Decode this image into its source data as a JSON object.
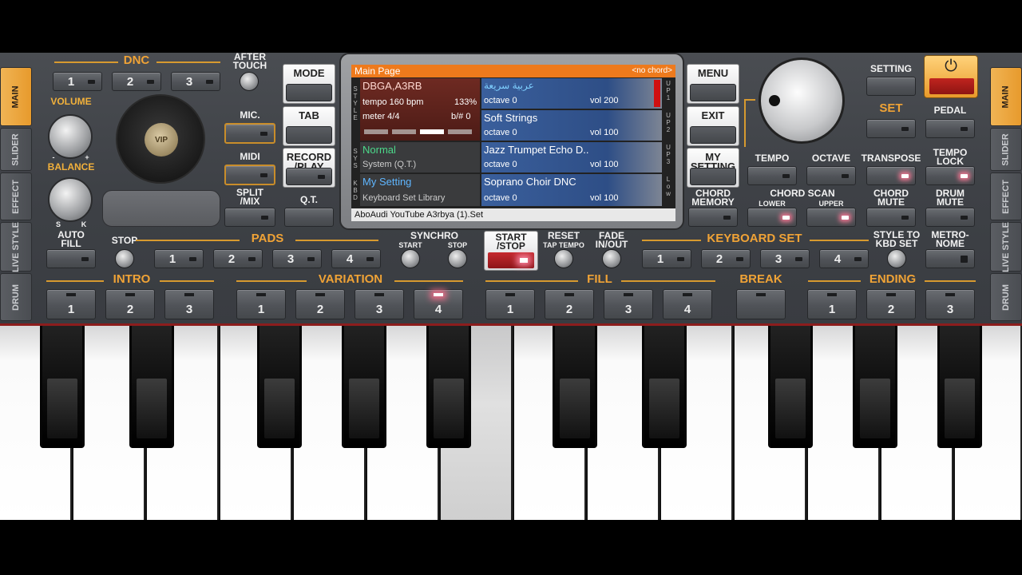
{
  "side_tabs_left": [
    "MAIN",
    "SLIDER",
    "EFFECT",
    "LIVE STYLE",
    "DRUM"
  ],
  "side_tabs_right": [
    "MAIN",
    "SLIDER",
    "EFFECT",
    "LIVE STYLE",
    "DRUM"
  ],
  "dnc": {
    "label": "DNC",
    "buttons": [
      "1",
      "2",
      "3"
    ]
  },
  "after_touch": "AFTER TOUCH",
  "volume": "VOLUME",
  "balance": "BALANCE",
  "balance_s": "S",
  "balance_k": "K",
  "knob_minus": "-",
  "knob_plus": "+",
  "vip": "VIP",
  "mic": "MIC.",
  "midi": "MIDI",
  "split_mix": "SPLIT /MIX",
  "mode": "MODE",
  "tab": "TAB",
  "record_play": "RECORD /PLAY",
  "qt": "Q.T.",
  "menu": "MENU",
  "exit": "EXIT",
  "my_setting": "MY SETTING",
  "chord_memory": "CHORD MEMORY",
  "setting": "SETTING",
  "set": "SET",
  "pedal": "PEDAL",
  "tempo": "TEMPO",
  "octave": "OCTAVE",
  "transpose": "TRANSPOSE",
  "tempo_lock": "TEMPO LOCK",
  "chord_scan": "CHORD SCAN",
  "lower": "LOWER",
  "upper": "UPPER",
  "chord_mute": "CHORD MUTE",
  "drum_mute": "DRUM MUTE",
  "screen": {
    "header": "Main Page",
    "no_chord": "<no chord>",
    "style_name": "DBGA,A3RB",
    "tempo": "tempo 160 bpm",
    "tempo_pct": "133%",
    "meter": "meter 4/4",
    "bsharp": "b/# 0",
    "sys_mode": "Normal",
    "sys_sub": "System (Q.T.)",
    "kbd_name": "My Setting",
    "kbd_sub": "Keyboard Set Library",
    "footer": "AboAudi YouTube A3rbya (1).Set",
    "vert_style": "STYLE",
    "vert_sys": "SYS",
    "vert_kbd": "KBD",
    "parts": [
      {
        "name": "عربية سريعة",
        "octave": "octave  0",
        "vol": "vol 200",
        "tag": "UP1"
      },
      {
        "name": "Soft Strings",
        "octave": "octave  0",
        "vol": "vol 100",
        "tag": "UP2"
      },
      {
        "name": "Jazz Trumpet Echo D..",
        "octave": "octave  0",
        "vol": "vol 100",
        "tag": "UP3"
      },
      {
        "name": "Soprano Choir DNC",
        "octave": "octave  0",
        "vol": "vol 100",
        "tag": "Low"
      }
    ]
  },
  "auto_fill": "AUTO FILL",
  "stop": "STOP",
  "pads": {
    "label": "PADS",
    "buttons": [
      "1",
      "2",
      "3",
      "4"
    ]
  },
  "synchro": "SYNCHRO",
  "synchro_start": "START",
  "synchro_stop": "STOP",
  "start_stop": "START /STOP",
  "reset": "RESET",
  "tap_tempo": "TAP TEMPO",
  "fade": "FADE IN/OUT",
  "keyboard_set": {
    "label": "KEYBOARD SET",
    "buttons": [
      "1",
      "2",
      "3",
      "4"
    ]
  },
  "style_to_kbd": "STYLE TO KBD SET",
  "metronome": "METRO- NOME",
  "intro": {
    "label": "INTRO",
    "buttons": [
      "1",
      "2",
      "3"
    ]
  },
  "variation": {
    "label": "VARIATION",
    "buttons": [
      "1",
      "2",
      "3",
      "4"
    ]
  },
  "fill": {
    "label": "FILL",
    "buttons": [
      "1",
      "2",
      "3",
      "4"
    ]
  },
  "break": {
    "label": "BREAK"
  },
  "ending": {
    "label": "ENDING",
    "buttons": [
      "1",
      "2",
      "3"
    ]
  },
  "colors": {
    "accent": "#f0a336",
    "header_bar": "#ee7a1c",
    "led_active": "#ff7a95",
    "start_red": "#b8242a"
  }
}
